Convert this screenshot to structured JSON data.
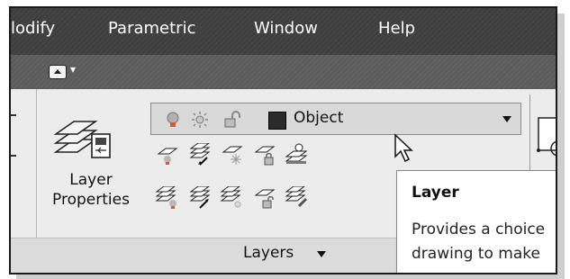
{
  "menubar": {
    "items": [
      "lodify",
      "Parametric",
      "Window",
      "Help"
    ]
  },
  "ribbon": {
    "layer_properties": {
      "line1": "Layer",
      "line2": "Properties"
    },
    "layer_combo": {
      "value": "Object"
    },
    "panel_label": "Layers"
  },
  "tooltip": {
    "title": "Layer",
    "line1": "Provides a choice",
    "line2": "drawing to make"
  },
  "icons": {
    "lightbulb": "lightbulb-icon",
    "sun": "sun-icon",
    "unlock": "unlock-icon",
    "quick_access": "quick-access-dropdown"
  },
  "colors": {
    "menubar_bg": "#3d3d3d",
    "toolbar_bg": "#5a5a5a",
    "ribbon_bg": "#ececec",
    "layer_color_swatch": "#2b2b2b",
    "bulb": "#b0b0b0"
  }
}
